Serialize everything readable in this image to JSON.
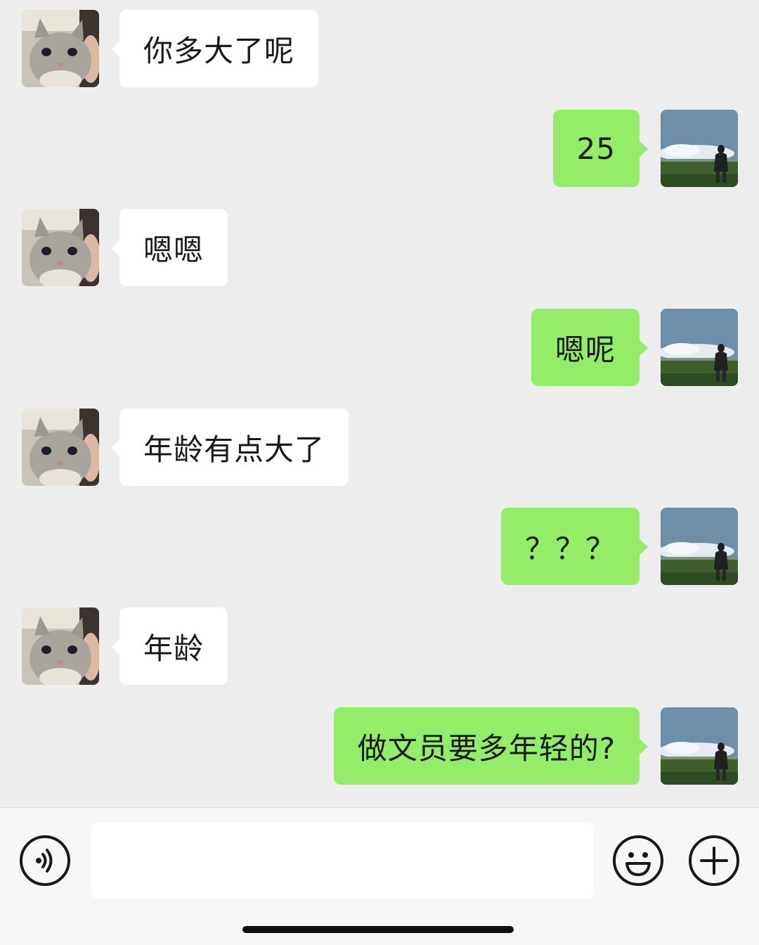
{
  "messages": [
    {
      "side": "left",
      "text": "你多大了呢"
    },
    {
      "side": "right",
      "text": "25"
    },
    {
      "side": "left",
      "text": "嗯嗯"
    },
    {
      "side": "right",
      "text": "嗯呢"
    },
    {
      "side": "left",
      "text": "年龄有点大了"
    },
    {
      "side": "right",
      "text": "？？？"
    },
    {
      "side": "left",
      "text": "年龄"
    },
    {
      "side": "right",
      "text": "做文员要多年轻的?"
    }
  ],
  "avatars": {
    "left": {
      "icon": "cat-photo-avatar"
    },
    "right": {
      "icon": "landscape-person-avatar"
    }
  },
  "input_bar": {
    "input_value": "",
    "voice_icon": "voice-icon",
    "emoji_icon": "emoji-icon",
    "plus_icon": "plus-icon"
  },
  "colors": {
    "background": "#ededed",
    "incoming_bubble": "#ffffff",
    "outgoing_bubble": "#95ec69",
    "text": "#191919"
  }
}
